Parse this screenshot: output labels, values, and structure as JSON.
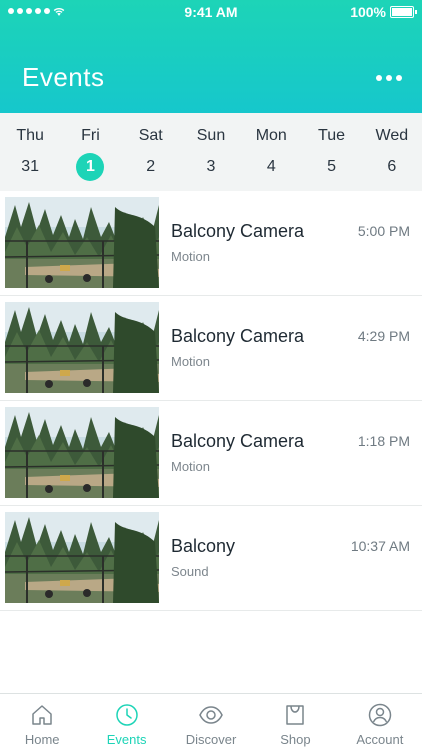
{
  "status_bar": {
    "time": "9:41 AM",
    "battery": "100%"
  },
  "header": {
    "title": "Events"
  },
  "days": [
    {
      "name": "Thu",
      "num": "31"
    },
    {
      "name": "Fri",
      "num": "1"
    },
    {
      "name": "Sat",
      "num": "2"
    },
    {
      "name": "Sun",
      "num": "3"
    },
    {
      "name": "Mon",
      "num": "4"
    },
    {
      "name": "Tue",
      "num": "5"
    },
    {
      "name": "Wed",
      "num": "6"
    }
  ],
  "events": [
    {
      "title": "Balcony Camera",
      "type": "Motion",
      "time": "5:00 PM"
    },
    {
      "title": "Balcony Camera",
      "type": "Motion",
      "time": "4:29 PM"
    },
    {
      "title": "Balcony Camera",
      "type": "Motion",
      "time": "1:18 PM"
    },
    {
      "title": "Balcony",
      "type": "Sound",
      "time": "10:37 AM"
    }
  ],
  "tabs": [
    {
      "label": "Home",
      "icon": "home-icon"
    },
    {
      "label": "Events",
      "icon": "clock-icon"
    },
    {
      "label": "Discover",
      "icon": "eye-icon"
    },
    {
      "label": "Shop",
      "icon": "bag-icon"
    },
    {
      "label": "Account",
      "icon": "user-icon"
    }
  ],
  "colors": {
    "accent": "#1dd4b7",
    "header_top": "#1dd4b7",
    "header_bottom": "#16c7cc"
  }
}
